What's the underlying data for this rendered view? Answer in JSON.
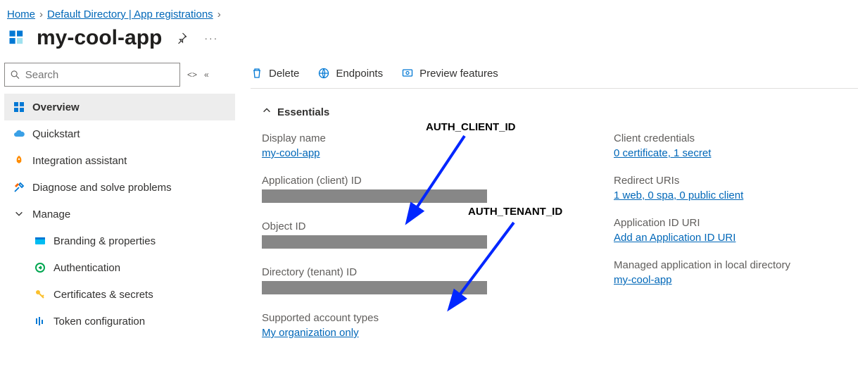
{
  "breadcrumb": {
    "home": "Home",
    "directory": "Default Directory | App registrations"
  },
  "page": {
    "title": "my-cool-app"
  },
  "search": {
    "placeholder": "Search"
  },
  "sidebar": {
    "overview": "Overview",
    "quickstart": "Quickstart",
    "integration": "Integration assistant",
    "diagnose": "Diagnose and solve problems",
    "manage": "Manage",
    "branding": "Branding & properties",
    "authentication": "Authentication",
    "certs": "Certificates & secrets",
    "token": "Token configuration"
  },
  "toolbar": {
    "delete": "Delete",
    "endpoints": "Endpoints",
    "preview": "Preview features"
  },
  "essentials": {
    "header": "Essentials",
    "display_name_label": "Display name",
    "display_name_value": "my-cool-app",
    "app_id_label": "Application (client) ID",
    "object_id_label": "Object ID",
    "tenant_id_label": "Directory (tenant) ID",
    "account_types_label": "Supported account types",
    "account_types_value": "My organization only",
    "client_creds_label": "Client credentials",
    "client_creds_value": "0 certificate, 1 secret",
    "redirect_label": "Redirect URIs",
    "redirect_value": "1 web, 0 spa, 0 public client",
    "app_uri_label": "Application ID URI",
    "app_uri_value": "Add an Application ID URI",
    "managed_label": "Managed application in local directory",
    "managed_value": "my-cool-app"
  },
  "annotations": {
    "client_id": "AUTH_CLIENT_ID",
    "tenant_id": "AUTH_TENANT_ID"
  }
}
